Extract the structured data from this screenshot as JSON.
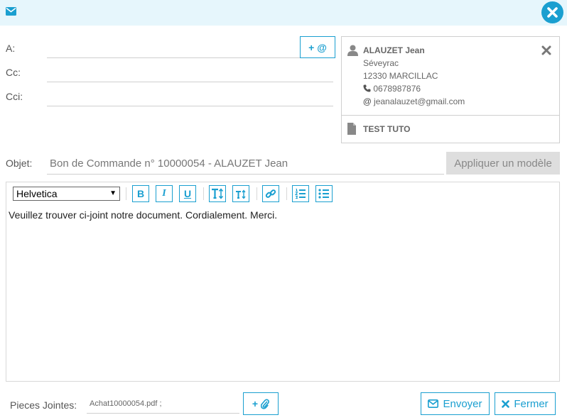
{
  "header": {
    "icon": "envelope-icon",
    "close_icon": "circle-close-icon",
    "accent": "#1a9fd0",
    "bar_color": "#e6f6fc"
  },
  "recipients": {
    "to_label": "A:",
    "cc_label": "Cc:",
    "bcc_label": "Cci:",
    "to_value": "",
    "cc_value": "",
    "bcc_value": "",
    "add_contact_label": "+ @"
  },
  "contact": {
    "name": "ALAUZET Jean",
    "address_line1": "Séveyrac",
    "address_line2": "12330 MARCILLAC",
    "phone": "0678987876",
    "email": "jeanalauzet@gmail.com",
    "document": "TEST TUTO"
  },
  "subject": {
    "label": "Objet:",
    "value": "Bon de Commande n° 10000054 - ALAUZET Jean",
    "template_button": "Appliquer un modèle"
  },
  "editor": {
    "font": "Helvetica",
    "toolbar": [
      "bold",
      "italic",
      "underline",
      "font-size-up",
      "font-size-down",
      "link",
      "ordered-list",
      "unordered-list"
    ],
    "body": "Veuillez trouver ci-joint notre document. Cordialement. Merci."
  },
  "attachments": {
    "label": "Pieces Jointes:",
    "value": "Achat10000054.pdf ;",
    "add_label": "+"
  },
  "actions": {
    "send": "Envoyer",
    "close": "Fermer"
  }
}
